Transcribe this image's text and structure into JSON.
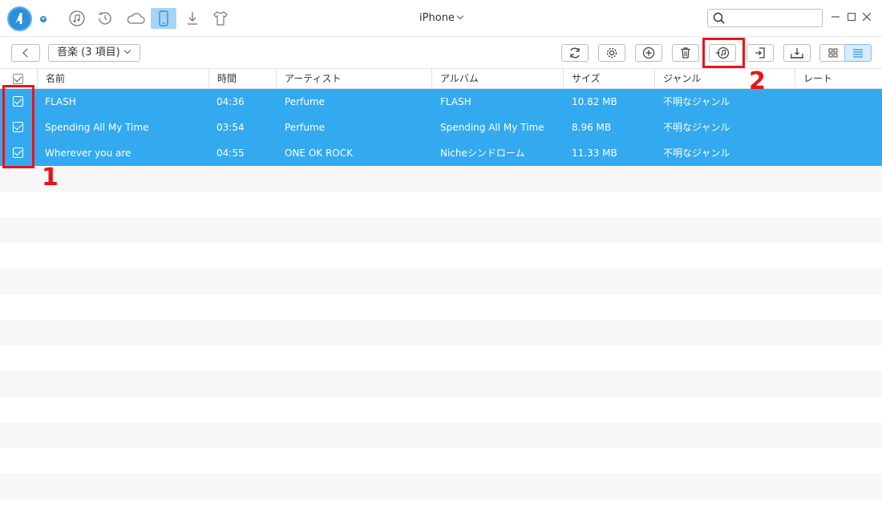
{
  "window": {
    "title": "iPhone",
    "search": {
      "placeholder": "",
      "value": ""
    }
  },
  "nav": {
    "items": [
      {
        "name": "music-library",
        "icon": "music-note-icon"
      },
      {
        "name": "backup",
        "icon": "history-icon"
      },
      {
        "name": "icloud",
        "icon": "cloud-icon"
      },
      {
        "name": "device",
        "icon": "phone-icon",
        "active": true
      },
      {
        "name": "download",
        "icon": "download-icon"
      },
      {
        "name": "toolkit",
        "icon": "tshirt-icon"
      }
    ]
  },
  "toolbar": {
    "category_label": "音楽 (3 項目)",
    "buttons": [
      "refresh-icon",
      "settings-icon",
      "add-icon",
      "delete-icon",
      "send-to-itunes-icon",
      "export-to-computer-icon",
      "send-to-device-icon",
      "grid-view-icon",
      "list-view-icon"
    ]
  },
  "table": {
    "columns": [
      "名前",
      "時間",
      "アーティスト",
      "アルバム",
      "サイズ",
      "ジャンル",
      "レート"
    ],
    "rows": [
      {
        "name": "FLASH",
        "time": "04:36",
        "artist": "Perfume",
        "album": "FLASH",
        "size": "10.82 MB",
        "genre": "不明なジャンル",
        "rate": ""
      },
      {
        "name": "Spending All My Time",
        "time": "03:54",
        "artist": "Perfume",
        "album": "Spending All My Time",
        "size": "8.96 MB",
        "genre": "不明なジャンル",
        "rate": ""
      },
      {
        "name": "Wherever you are",
        "time": "04:55",
        "artist": "ONE OK ROCK",
        "album": "Nicheシンドローム",
        "size": "11.33 MB",
        "genre": "不明なジャンル",
        "rate": ""
      }
    ]
  },
  "annotations": {
    "label1": "1",
    "label2": "2",
    "color": "#e8141c"
  },
  "colors": {
    "selection": "#33a9ef",
    "accent": "#2d8fd8"
  }
}
